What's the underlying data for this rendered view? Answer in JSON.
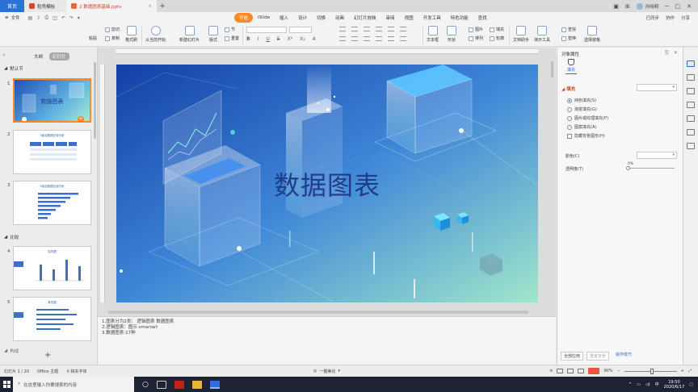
{
  "titlebar": {
    "home_tab": "首页",
    "tabs": [
      {
        "label": "稻壳模板",
        "color": "#d24726"
      },
      {
        "label": "2.数据图表基础.pptx",
        "color": "#e06b3c"
      }
    ],
    "user_name": "孙晓明"
  },
  "menubar": {
    "file_label": "文件",
    "menus": [
      "开始",
      "iSlide",
      "插入",
      "设计",
      "切换",
      "动画",
      "幻灯片放映",
      "审阅",
      "视图",
      "开发工具",
      "特色功能",
      "查找"
    ],
    "active_menu": "开始",
    "right_items": [
      "已同步",
      "协作",
      "分享"
    ]
  },
  "ribbon": {
    "cut": "剪切",
    "copy": "复制",
    "format_painter": "格式刷",
    "paste": "粘贴",
    "play_from_current": "从当前开始",
    "new_slide": "新建幻灯片",
    "layout": "版式",
    "section": "节",
    "reset": "重置",
    "textbox": "文本框",
    "shape": "形状",
    "arrange": "排列",
    "picture": "图片",
    "fill": "填充",
    "outline": "轮廓",
    "find": "查找",
    "replace": "替换",
    "doc_assistant": "文档助手",
    "presentation_tools": "演示工具",
    "select_pane": "选择窗格"
  },
  "left_panel": {
    "tabs": [
      "大纲",
      "幻灯片"
    ],
    "active_tab": "幻灯片",
    "sections": [
      {
        "label": "默认节"
      },
      {
        "label": "比较"
      },
      {
        "label": "构成"
      }
    ],
    "slides": [
      {
        "num": "1",
        "title": "数据图表"
      },
      {
        "num": "2",
        "title": "3组合数据比较分析"
      },
      {
        "num": "3",
        "title": "3组合数据比较分析"
      },
      {
        "num": "4",
        "title": "柱形图"
      },
      {
        "num": "5",
        "title": "条形图"
      }
    ]
  },
  "slide": {
    "title": "数据图表",
    "background_start": "#1542a8",
    "background_end": "#8fe0c8"
  },
  "notes": {
    "lines": [
      "1.图表分为2类： 逻辑图表 数据图表",
      "2.逻辑图表：图示 smartart",
      "3.数据图表:17种"
    ]
  },
  "right_pane": {
    "title": "对象属性",
    "fill_tab": "填充",
    "section": "填充",
    "options": [
      {
        "label": "纯色填充(S)",
        "checked": true
      },
      {
        "label": "渐变填充(G)",
        "checked": false
      },
      {
        "label": "图片或纹理填充(P)",
        "checked": false
      },
      {
        "label": "图案填充(A)",
        "checked": false
      }
    ],
    "hide_bg": "隐藏背景图形(H)",
    "color_label": "颜色(C)",
    "transparency_label": "透明度(T)",
    "transparency_value": "0%",
    "apply_all": "全部应用",
    "reset_bg": "重置背景",
    "tips": "操作技巧"
  },
  "statusbar": {
    "slide_count": "幻灯片 1 / 20",
    "theme": "Office 主题",
    "missing_font": "缺失字体",
    "beautify": "一键美化",
    "zoom": "90%"
  },
  "taskbar": {
    "search_placeholder": "在这里输入你要搜索的内容",
    "time": "19:50",
    "date": "2020/6/17"
  }
}
